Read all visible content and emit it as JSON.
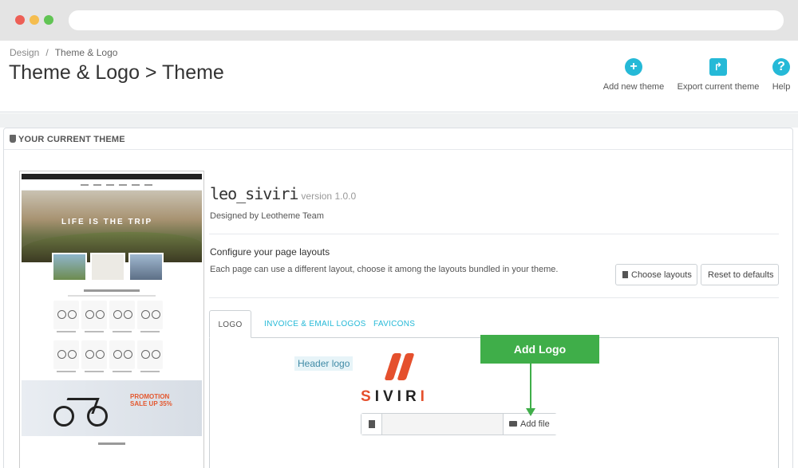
{
  "breadcrumb": {
    "parent": "Design",
    "separator": "/",
    "current": "Theme & Logo"
  },
  "page_title": "Theme & Logo > Theme",
  "toolbar": {
    "add_new_theme": "Add new theme",
    "export_current_theme": "Export current theme",
    "help": "Help",
    "add_icon_glyph": "+",
    "export_icon_glyph": "↱",
    "help_icon_glyph": "?",
    "accent_color": "#25b9d7"
  },
  "panel": {
    "heading": "YOUR CURRENT THEME"
  },
  "preview": {
    "slogan": "LIFE IS THE TRIP",
    "promo": "PROMOTION SALE UP 35%"
  },
  "theme": {
    "name": "leo_siviri",
    "version": "version 1.0.0",
    "designed_by": "Designed by Leotheme Team"
  },
  "layouts": {
    "title": "Configure your page layouts",
    "description": "Each page can use a different layout, choose it among the layouts bundled in your theme.",
    "choose_button": "Choose layouts",
    "reset_button": "Reset to defaults"
  },
  "tabs": [
    {
      "label": "LOGO",
      "active": true
    },
    {
      "label": "INVOICE & EMAIL LOGOS",
      "active": false
    },
    {
      "label": "FAVICONS",
      "active": false
    }
  ],
  "logo_tab": {
    "header_logo_label": "Header logo",
    "logo_text": "SIVIRI",
    "add_file_button": "Add file"
  },
  "annotation": {
    "label": "Add Logo",
    "color": "#3fae49"
  }
}
